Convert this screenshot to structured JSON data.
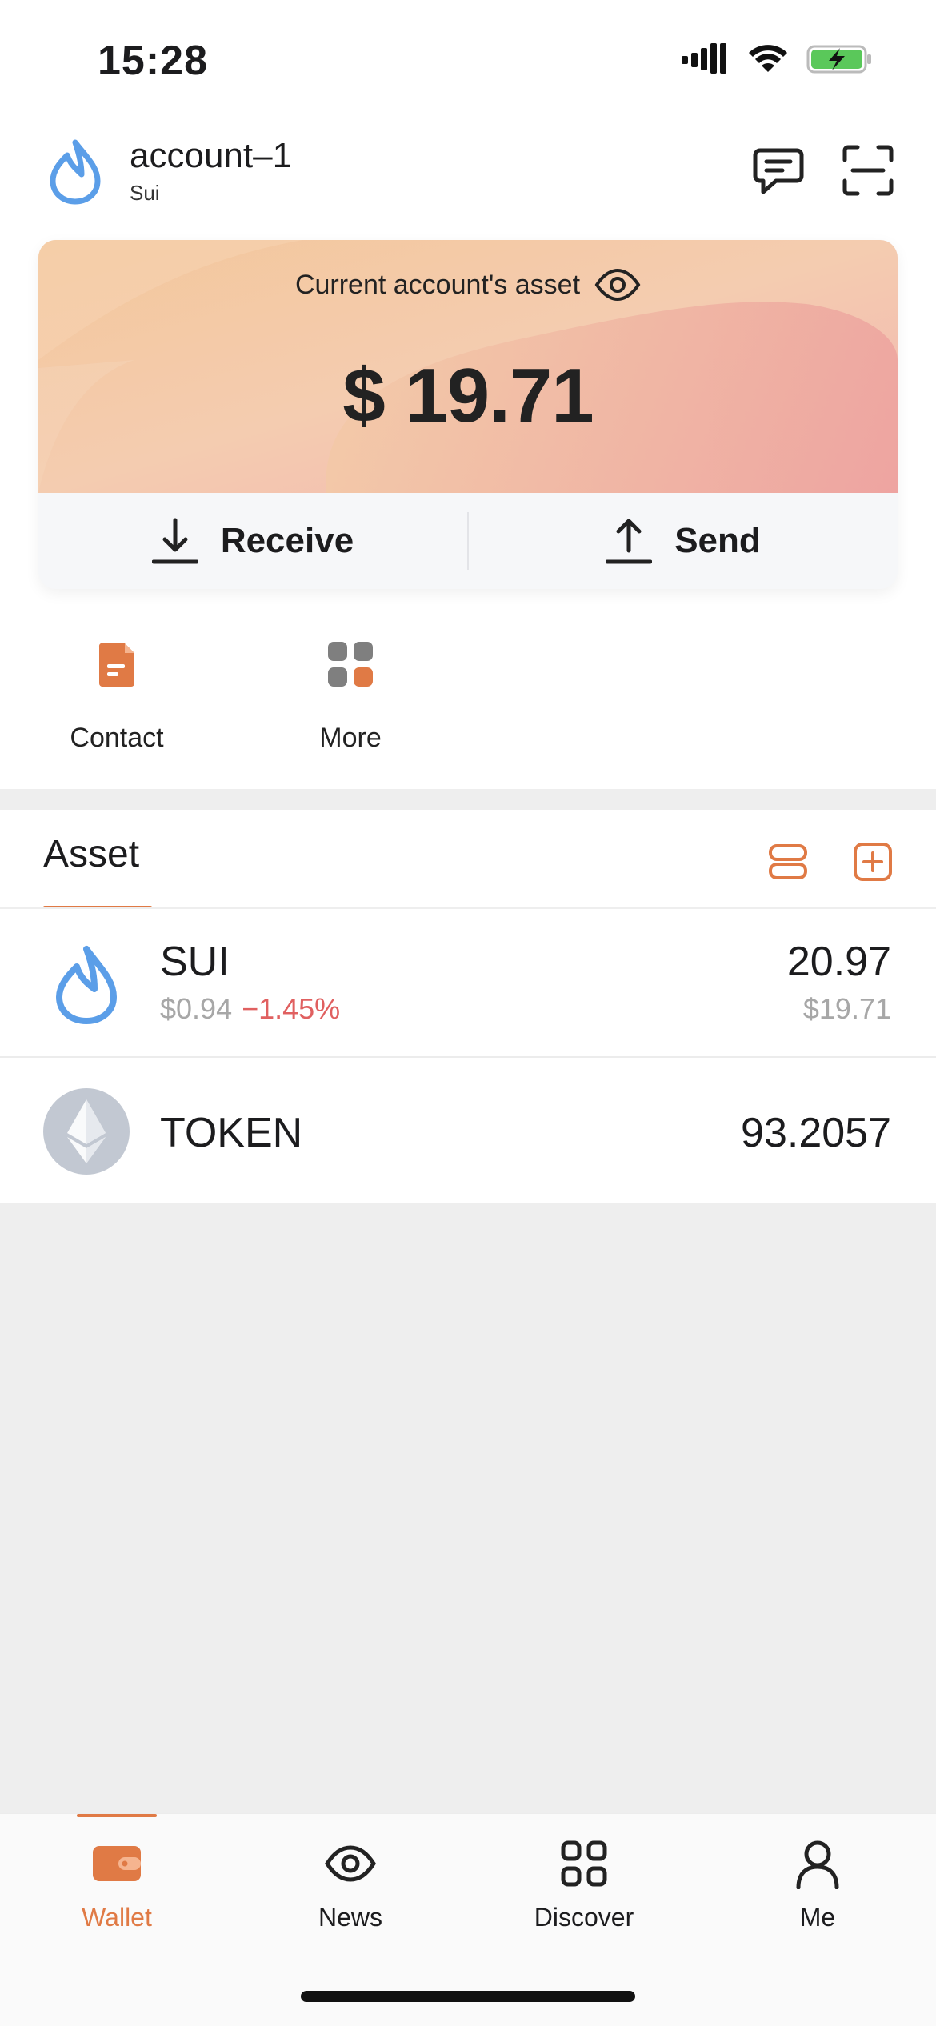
{
  "status_bar": {
    "time": "15:28"
  },
  "header": {
    "account_name": "account–1",
    "chain": "Sui",
    "icons": [
      "sui-drop-logo",
      "chat-icon",
      "scan-icon"
    ]
  },
  "asset_card": {
    "title": "Current account's asset",
    "amount": "$ 19.71",
    "receive_label": "Receive",
    "send_label": "Send"
  },
  "quick_actions": [
    {
      "label": "Contact",
      "icon": "contact-doc-icon"
    },
    {
      "label": "More",
      "icon": "more-grid-icon"
    }
  ],
  "asset_section": {
    "tab_label": "Asset",
    "tokens": [
      {
        "symbol": "SUI",
        "price": "$0.94",
        "change": "−1.45%",
        "amount": "20.97",
        "value": "$19.71",
        "icon": "sui-drop-logo"
      },
      {
        "symbol": "TOKEN",
        "amount": "93.2057",
        "icon": "ethereum-logo"
      }
    ]
  },
  "tab_bar": {
    "active": "Wallet",
    "tabs": [
      {
        "label": "Wallet",
        "icon": "wallet-icon"
      },
      {
        "label": "News",
        "icon": "eye-icon"
      },
      {
        "label": "Discover",
        "icon": "grid-icon"
      },
      {
        "label": "Me",
        "icon": "person-icon"
      }
    ]
  },
  "colors": {
    "accent": "#e07a45",
    "negative": "#e06060",
    "sui_blue": "#5b9ee8"
  }
}
